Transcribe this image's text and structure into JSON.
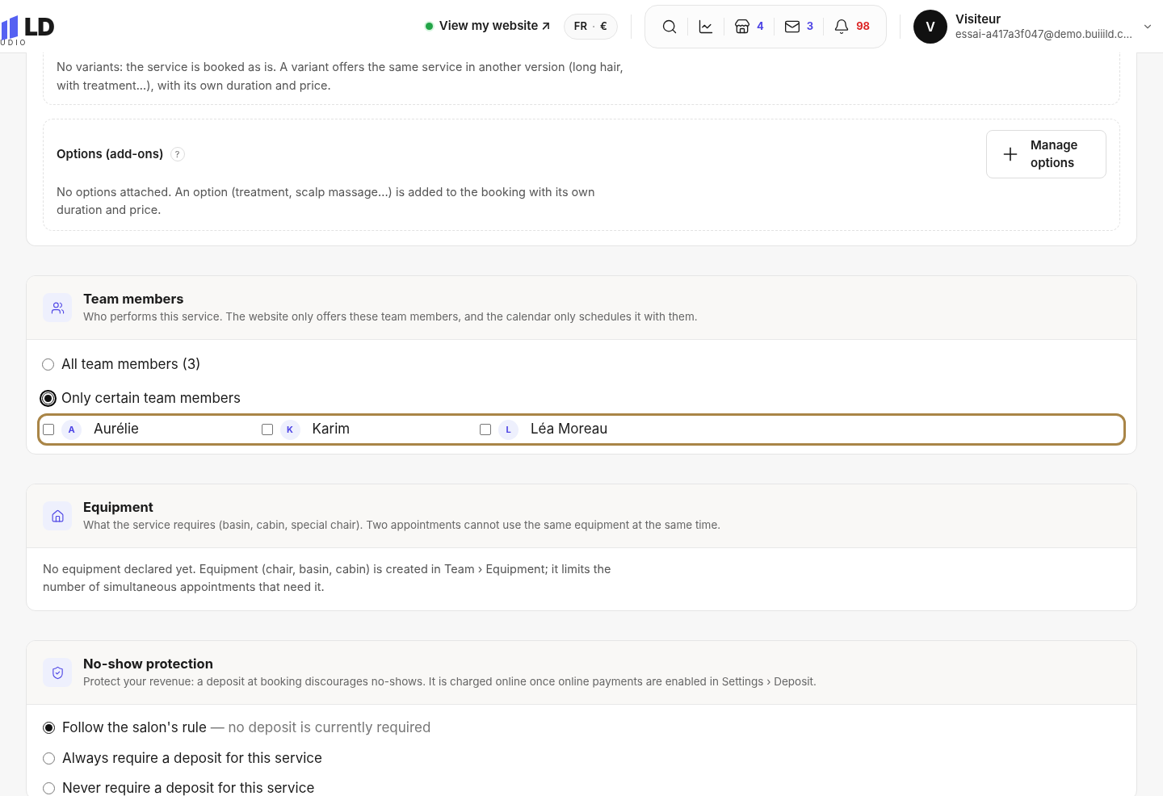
{
  "header": {
    "logo": {
      "mark": "LD",
      "sub": "UDIO"
    },
    "site_link": {
      "label": "View my website ↗",
      "online": true
    },
    "locale": {
      "lang": "FR",
      "separator": "·",
      "currency": "€"
    },
    "tools": [
      {
        "kind": "search"
      },
      {
        "kind": "stats"
      },
      {
        "kind": "shop",
        "count": "4",
        "color": "#4f46e5"
      },
      {
        "kind": "mail",
        "count": "3",
        "color": "#4f46e5"
      },
      {
        "kind": "bell",
        "count": "98",
        "color": "#dc2626"
      }
    ],
    "user": {
      "initial": "V",
      "name": "Visiteur",
      "email": "essai-a417a3f047@demo.buiiild.c..."
    }
  },
  "variants": {
    "text": "No variants: the service is booked as is. A variant offers the same service in another version (long hair, with treatment...), with its own duration and price."
  },
  "options": {
    "title": "Options (add-ons)",
    "help": "?",
    "button": "Manage options",
    "text": "No options attached. An option (treatment, scalp massage...) is added to the booking with its own duration and price."
  },
  "sections": [
    {
      "kind": "team",
      "title": "Team members",
      "subtitle": "Who performs this service. The website only offers these team members, and the calendar only schedules it with them.",
      "choices": [
        {
          "label": "All team members (3)",
          "selected": false
        },
        {
          "label": "Only certain team members",
          "selected": true
        }
      ],
      "members": [
        {
          "initial": "A",
          "name": "Aurélie",
          "checked": false
        },
        {
          "initial": "K",
          "name": "Karim",
          "checked": false
        },
        {
          "initial": "L",
          "name": "Léa Moreau",
          "checked": false
        }
      ]
    },
    {
      "kind": "equipment",
      "title": "Equipment",
      "subtitle": "What the service requires (basin, cabin, special chair). Two appointments cannot use the same equipment at the same time.",
      "text": "No equipment declared yet. Equipment (chair, basin, cabin) is created in Team › Equipment; it limits the number of simultaneous appointments that need it."
    },
    {
      "kind": "noshow",
      "title": "No-show protection",
      "subtitle": "Protect your revenue: a deposit at booking discourages no-shows. It is charged online once online payments are enabled in Settings › Deposit.",
      "choices": [
        {
          "label": "Follow the salon's rule",
          "note": "— no deposit is currently required",
          "selected": true
        },
        {
          "label": "Always require a deposit for this service",
          "selected": false
        },
        {
          "label": "Never require a deposit for this service",
          "selected": false
        }
      ]
    }
  ]
}
